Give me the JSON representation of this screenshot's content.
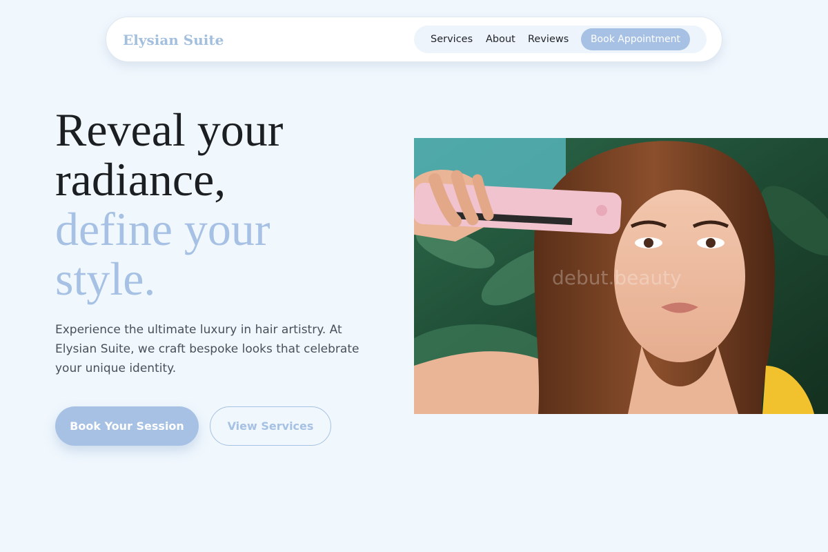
{
  "nav": {
    "brand": "Elysian Suite",
    "links": [
      "Services",
      "About",
      "Reviews"
    ],
    "cta_label": "Book Appointment"
  },
  "hero": {
    "headline": [
      "Reveal your",
      "radiance,"
    ],
    "headline_accent": [
      "define your",
      "style."
    ],
    "subtitle": "Experience the ultimate luxury in hair artistry. At Elysian Suite, we craft bespoke looks that celebrate your unique identity.",
    "primary_button": "Book Your Session",
    "secondary_button": "View Services",
    "image": {
      "watermark": "debut.beauty"
    }
  },
  "colors": {
    "page_background": "#f0f7fd",
    "accent": "#a6c1e3",
    "text_dark": "#1c1f22",
    "text_body": "#4a5059"
  }
}
